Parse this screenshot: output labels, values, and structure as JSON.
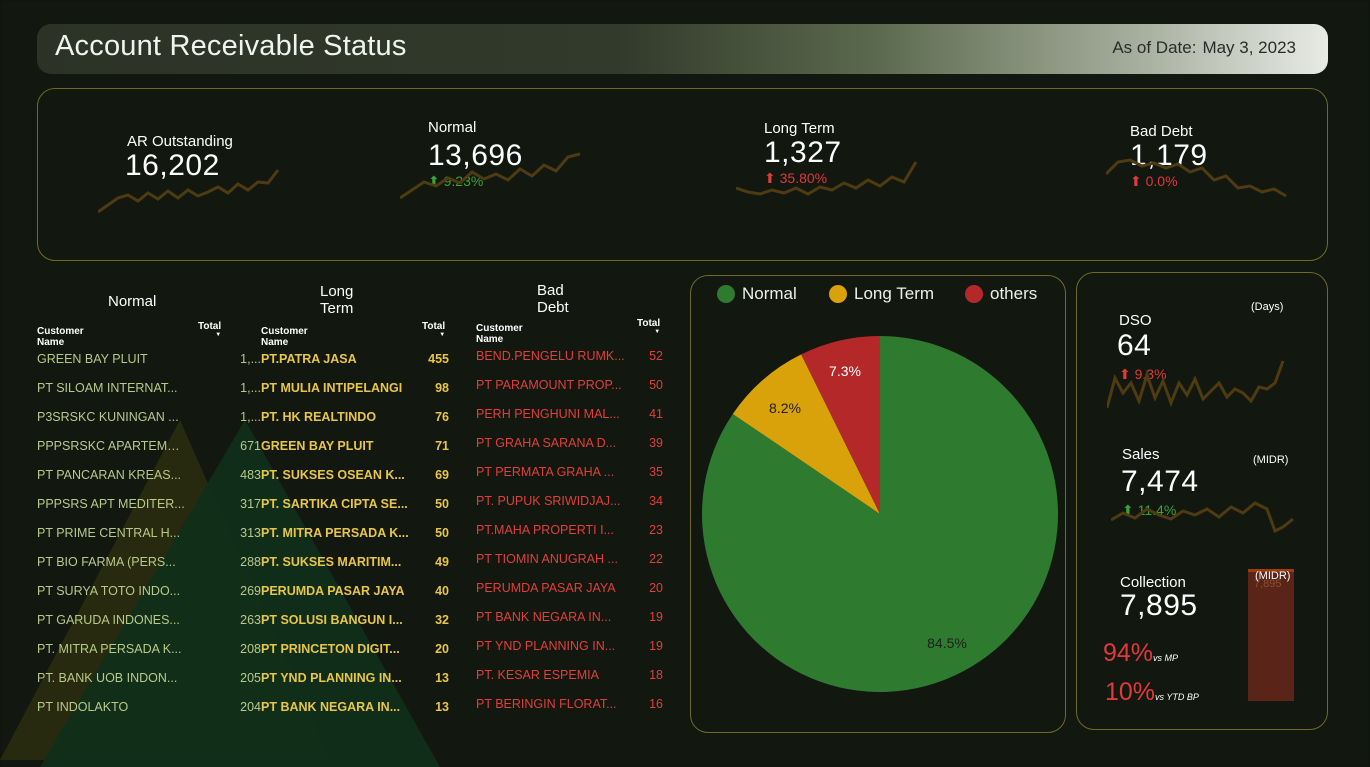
{
  "header": {
    "title": "Account Receivable Status",
    "as_of_label": "As of Date:",
    "as_of_date": "May 3, 2023"
  },
  "kpis": [
    {
      "label": "AR Outstanding",
      "value": "16,202",
      "delta": ""
    },
    {
      "label": "Normal",
      "value": "13,696",
      "delta": "9.23%",
      "trend": "up",
      "delta_color": "#3aa33a"
    },
    {
      "label": "Long Term",
      "value": "1,327",
      "delta": "35.80%",
      "trend": "up",
      "delta_color": "#e03a3a"
    },
    {
      "label": "Bad Debt",
      "value": "1,179",
      "delta": "0.0%",
      "trend": "up",
      "delta_color": "#e03a3a"
    }
  ],
  "tables": {
    "normal": {
      "title": "Normal",
      "col_name": "Customer Name",
      "col_total": "Total",
      "color": "#b9c98a",
      "rows": [
        {
          "name": "GREEN BAY PLUIT",
          "total": "1,..."
        },
        {
          "name": "PT SILOAM INTERNAT...",
          "total": "1,..."
        },
        {
          "name": "P3SRSKC KUNINGAN ...",
          "total": "1,..."
        },
        {
          "name": "PPPSRSKC APARTEME...",
          "total": "671"
        },
        {
          "name": "PT PANCARAN KREAS...",
          "total": "483"
        },
        {
          "name": "PPPSRS APT MEDITER...",
          "total": "317"
        },
        {
          "name": "PT PRIME CENTRAL H...",
          "total": "313"
        },
        {
          "name": "PT BIO FARMA (PERS...",
          "total": "288"
        },
        {
          "name": "PT SURYA TOTO INDO...",
          "total": "269"
        },
        {
          "name": "PT GARUDA INDONES...",
          "total": "263"
        },
        {
          "name": "PT. MITRA PERSADA K...",
          "total": "208"
        },
        {
          "name": "PT. BANK UOB INDON...",
          "total": "205"
        },
        {
          "name": "PT INDOLAKTO",
          "total": "204"
        }
      ]
    },
    "long_term": {
      "title": "Long Term",
      "col_name": "Customer Name",
      "col_total": "Total",
      "color": "#e8c648",
      "rows": [
        {
          "name": "PT.PATRA JASA",
          "total": "455"
        },
        {
          "name": "PT MULIA INTIPELANGI",
          "total": "98"
        },
        {
          "name": "PT. HK REALTINDO",
          "total": "76"
        },
        {
          "name": "GREEN BAY PLUIT",
          "total": "71"
        },
        {
          "name": "PT. SUKSES OSEAN K...",
          "total": "69"
        },
        {
          "name": "PT. SARTIKA CIPTA SE...",
          "total": "50"
        },
        {
          "name": "PT. MITRA PERSADA K...",
          "total": "50"
        },
        {
          "name": "PT. SUKSES MARITIM...",
          "total": "49"
        },
        {
          "name": "PERUMDA PASAR JAYA",
          "total": "40"
        },
        {
          "name": "PT SOLUSI BANGUN I...",
          "total": "32"
        },
        {
          "name": "PT PRINCETON DIGIT...",
          "total": "20"
        },
        {
          "name": "PT YND PLANNING IN...",
          "total": "13"
        },
        {
          "name": "PT BANK NEGARA IN...",
          "total": "13"
        }
      ]
    },
    "bad_debt": {
      "title": "Bad Debt",
      "col_name": "Customer Name",
      "col_total": "Total",
      "color": "#e0403a",
      "rows": [
        {
          "name": "BEND.PENGELU RUMK...",
          "total": "52"
        },
        {
          "name": "PT PARAMOUNT PROP...",
          "total": "50"
        },
        {
          "name": "PERH PENGHUNI MAL...",
          "total": "41"
        },
        {
          "name": "PT GRAHA SARANA D...",
          "total": "39"
        },
        {
          "name": "PT PERMATA GRAHA ...",
          "total": "35"
        },
        {
          "name": "PT. PUPUK SRIWIDJAJ...",
          "total": "34"
        },
        {
          "name": "PT.MAHA PROPERTI I...",
          "total": "23"
        },
        {
          "name": "PT TIOMIN ANUGRAH ...",
          "total": "22"
        },
        {
          "name": "PERUMDA PASAR JAYA",
          "total": "20"
        },
        {
          "name": "PT BANK NEGARA IN...",
          "total": "19"
        },
        {
          "name": "PT YND PLANNING IN...",
          "total": "19"
        },
        {
          "name": "PT. KESAR ESPEMIA",
          "total": "18"
        },
        {
          "name": "PT BERINGIN FLORAT...",
          "total": "16"
        }
      ]
    }
  },
  "chart_data": {
    "type": "pie",
    "slices": [
      {
        "name": "Normal",
        "value": 84.5,
        "label": "84.5%",
        "color": "#2e7a2e"
      },
      {
        "name": "Long Term",
        "value": 8.2,
        "label": "8.2%",
        "color": "#d9a20a"
      },
      {
        "name": "others",
        "value": 7.3,
        "label": "7.3%",
        "color": "#b5282a"
      }
    ],
    "legend_position": "top"
  },
  "right": {
    "dso": {
      "label": "DSO",
      "unit": "(Days)",
      "value": "64",
      "delta": "9.3%",
      "trend": "up",
      "delta_color": "#e03a3a"
    },
    "sales": {
      "label": "Sales",
      "unit": "(MIDR)",
      "value": "7,474",
      "delta": "11.4%",
      "trend": "up",
      "delta_color": "#3aa33a"
    },
    "collection": {
      "label": "Collection",
      "unit": "(MIDR)",
      "value": "7,895",
      "vs_mp_pct": "94%",
      "vs_mp_label": "vs MP",
      "vs_ytd_pct": "10%",
      "vs_ytd_label": "vs YTD BP",
      "bar_value": "7,895",
      "colors": {
        "pct": "#e03a3a",
        "bar": "#5a2418"
      }
    }
  },
  "colors": {
    "accent_border": "#6d6a2a",
    "sparkline": "#4f3b12"
  }
}
